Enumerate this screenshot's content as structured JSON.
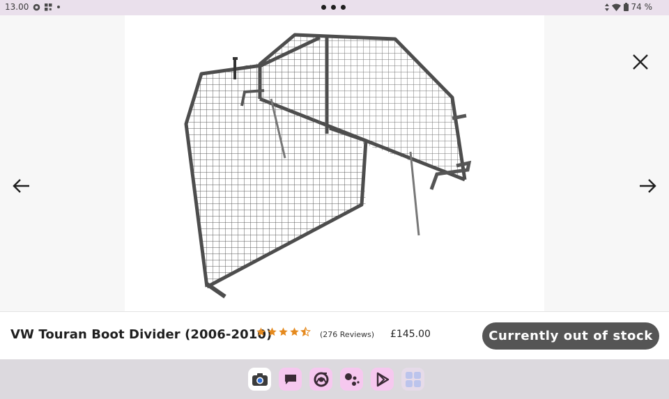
{
  "status_bar": {
    "time": "13.00",
    "battery": "74 %"
  },
  "product": {
    "title": "VW Touran Boot Divider (2006-2010)",
    "rating": 4.5,
    "reviews": "(276 Reviews)",
    "price": "£145.00",
    "stock_button": "Currently out of stock"
  },
  "colors": {
    "star": "#e58a1f",
    "button": "#555555",
    "status_bar": "#eae0ec",
    "dock": "#dcd9de"
  },
  "icons": {
    "close": "close-icon",
    "prev": "arrow-left-icon",
    "next": "arrow-right-icon"
  },
  "dock_apps": [
    "camera-app",
    "messages-app",
    "chrome-app",
    "assistant-app",
    "play-store-app",
    "app-drawer"
  ]
}
